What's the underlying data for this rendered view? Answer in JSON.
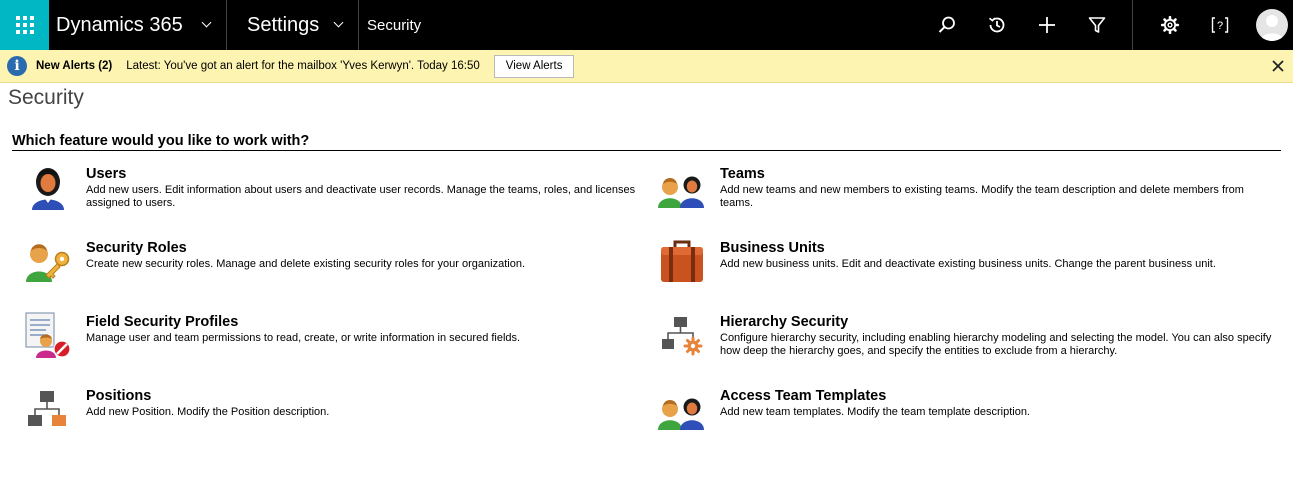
{
  "topbar": {
    "app_name": "Dynamics 365",
    "area_name": "Settings",
    "breadcrumb": "Security",
    "icons": [
      "search-icon",
      "history-icon",
      "plus-icon",
      "filter-icon",
      "gear-icon",
      "help-icon",
      "avatar"
    ]
  },
  "alert": {
    "title": "New Alerts (2)",
    "message": "Latest: You've got an alert for the mailbox 'Yves Kerwyn'. Today 16:50",
    "button": "View Alerts"
  },
  "page": {
    "title": "Security",
    "question": "Which feature would you like to work with?"
  },
  "features": {
    "users": {
      "name": "Users",
      "desc": "Add new users. Edit information about users and deactivate user records. Manage the teams, roles, and licenses assigned to users.",
      "icon": "user-icon"
    },
    "teams": {
      "name": "Teams",
      "desc": "Add new teams and new members to existing teams. Modify the team description and delete members from teams.",
      "icon": "team-icon"
    },
    "security_roles": {
      "name": "Security Roles",
      "desc": "Create new security roles. Manage and delete existing security roles for your organization.",
      "icon": "security-role-icon"
    },
    "business_units": {
      "name": "Business Units",
      "desc": "Add new business units. Edit and deactivate existing business units. Change the parent business unit.",
      "icon": "briefcase-icon"
    },
    "field_security": {
      "name": "Field Security Profiles",
      "desc": "Manage user and team permissions to read, create, or write information in secured fields.",
      "icon": "field-security-icon"
    },
    "hierarchy_security": {
      "name": "Hierarchy Security",
      "desc": "Configure hierarchy security, including enabling hierarchy modeling and selecting the model. You can also specify how deep the hierarchy goes, and specify the entities to exclude from a hierarchy.",
      "icon": "hierarchy-security-icon"
    },
    "positions": {
      "name": "Positions",
      "desc": "Add new Position. Modify the Position description.",
      "icon": "hierarchy-icon"
    },
    "access_team_templates": {
      "name": "Access Team Templates",
      "desc": "Add new team templates. Modify the team template description.",
      "icon": "team-template-icon"
    }
  },
  "colors": {
    "waffle": "#00b7c3",
    "topbar": "#000000",
    "alert_bg": "#fcf4b0",
    "info": "#2a6bb0",
    "accent_orange": "#e8833a"
  }
}
